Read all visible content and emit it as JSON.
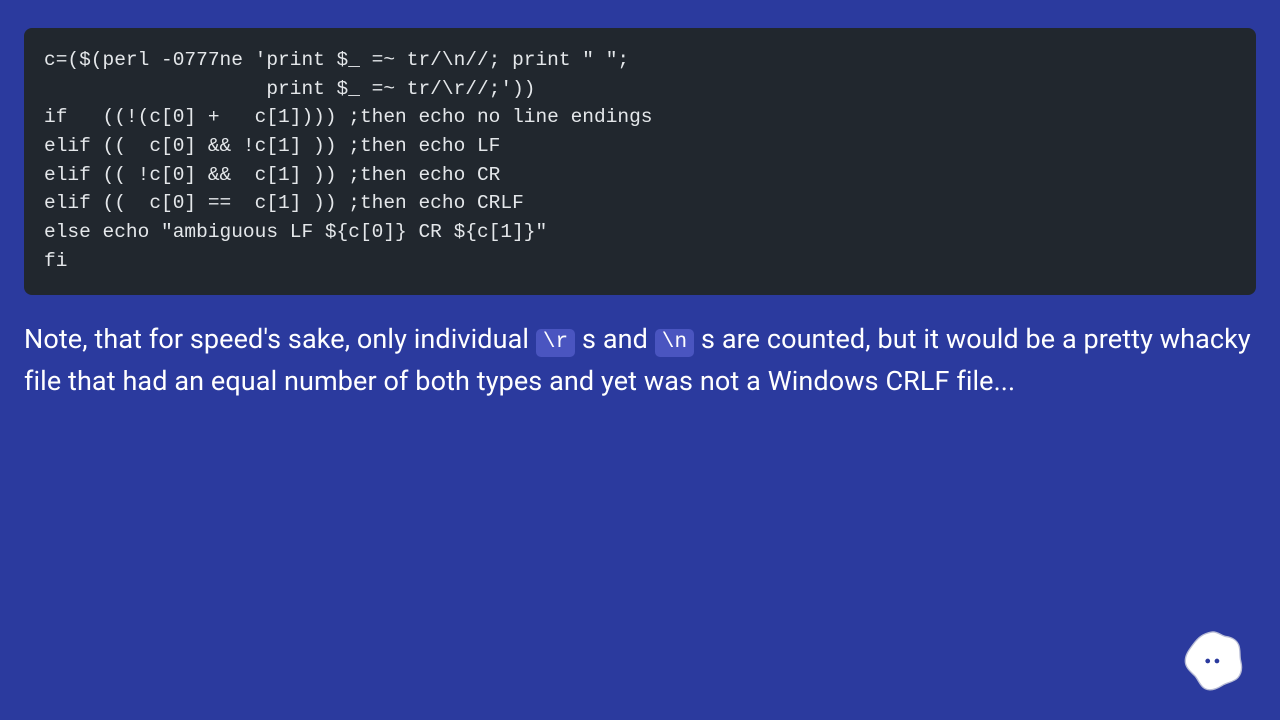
{
  "code": {
    "lines": [
      "c=($(perl -0777ne 'print $_ =~ tr/\\n//; print \" \";",
      "                   print $_ =~ tr/\\r//;'))",
      "if   ((!(c[0] +   c[1]))) ;then echo no line endings",
      "elif ((  c[0] && !c[1] )) ;then echo LF",
      "elif (( !c[0] &&  c[1] )) ;then echo CR",
      "elif ((  c[0] ==  c[1] )) ;then echo CRLF",
      "else echo \"ambiguous LF ${c[0]} CR ${c[1]}\"",
      "fi"
    ]
  },
  "note": {
    "part1": "Note, that for speed's sake, only individual ",
    "code1": "\\r",
    "part2": " s and ",
    "code2": "\\n",
    "part3": " s are counted, but it would be a pretty whacky file that had an equal number of both types and yet was not a Windows CRLF file..."
  },
  "blob": {
    "name": "assistant-avatar"
  }
}
